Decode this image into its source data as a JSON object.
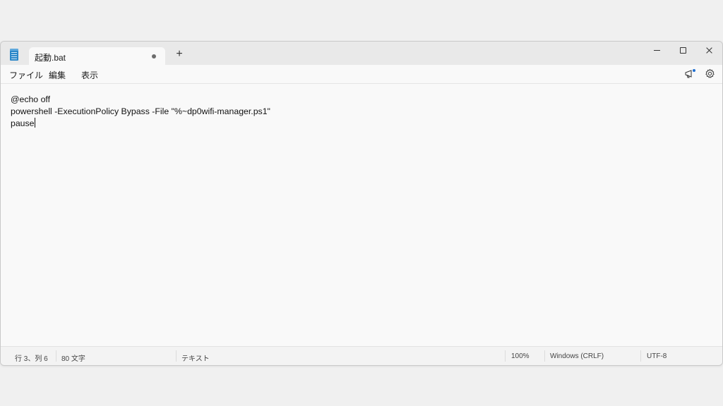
{
  "tab": {
    "title": "起動.bat"
  },
  "titlebar": {
    "new_tab_label": "+"
  },
  "menu": {
    "file": "ファイル",
    "edit": "編集",
    "view": "表示"
  },
  "editor": {
    "lines": [
      "@echo off",
      "powershell -ExecutionPolicy Bypass -File \"%~dp0wifi-manager.ps1\"",
      "pause"
    ]
  },
  "status": {
    "position": "行 3、列 6",
    "char_count": "80 文字",
    "format": "テキスト",
    "zoom": "100%",
    "line_ending": "Windows (CRLF)",
    "encoding": "UTF-8"
  },
  "colors": {
    "accent": "#2b87c8",
    "notification_dot": "#1f6fd1"
  },
  "icons": [
    "notepad-app-icon",
    "unsaved-dot-icon",
    "new-tab-icon",
    "minimize-icon",
    "maximize-icon",
    "close-icon",
    "whats-new-megaphone-icon",
    "settings-gear-icon"
  ]
}
